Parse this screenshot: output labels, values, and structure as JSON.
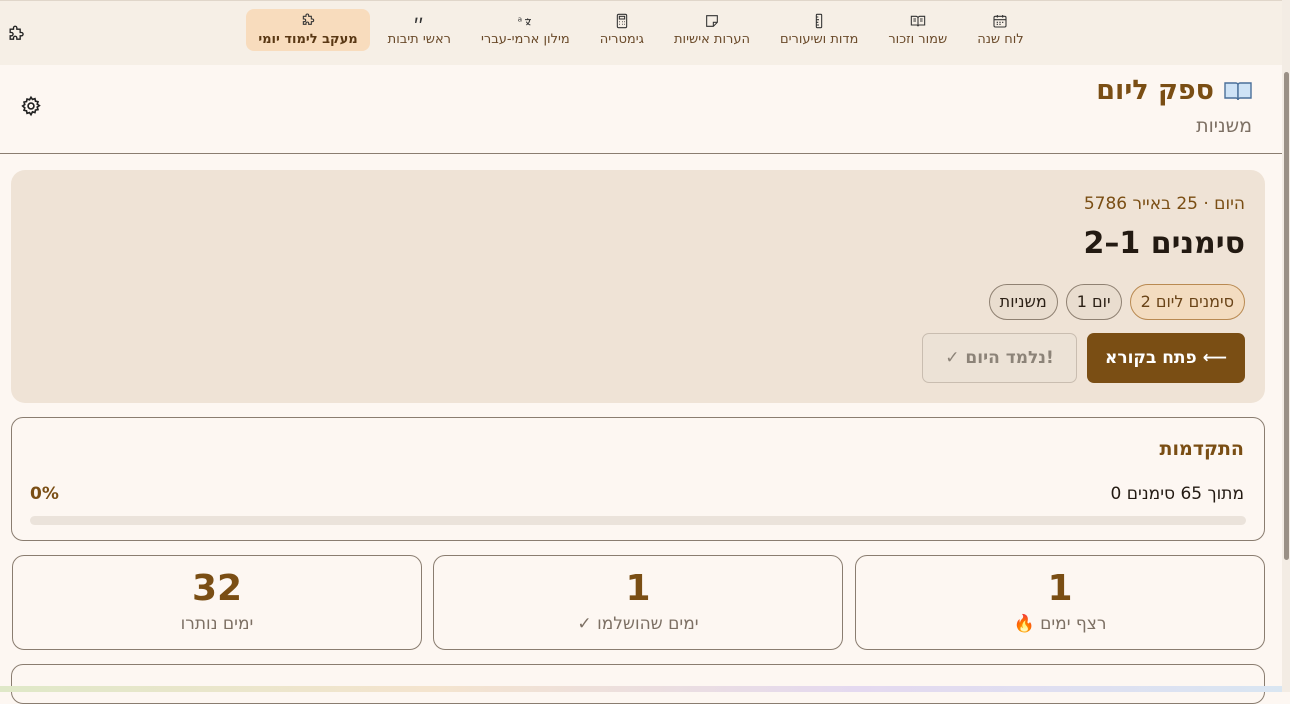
{
  "nav": {
    "items": [
      {
        "label": "לוח שנה",
        "icon": "calendar-icon"
      },
      {
        "label": "שמור וזכור",
        "icon": "open-book-icon"
      },
      {
        "label": "מדות ושיעורים",
        "icon": "ruler-icon"
      },
      {
        "label": "הערות אישיות",
        "icon": "note-icon"
      },
      {
        "label": "גימטריה",
        "icon": "calculator-icon"
      },
      {
        "label": "מילון ארמי-עברי",
        "icon": "translate-icon"
      },
      {
        "label": "ראשי תיבות",
        "icon": "quote-icon"
      },
      {
        "label": "מעקב לימוד יומי",
        "icon": "puzzle-icon",
        "active": true
      }
    ]
  },
  "header": {
    "title": "ספק ליום",
    "subtitle": "משניות"
  },
  "today": {
    "date": "היום · 25 באייר 5786",
    "range": "סימנים 1–2",
    "badges": [
      "2 סימנים ליום",
      "יום 1",
      "משניות"
    ],
    "open_button": "פתח בקורא ⟵",
    "learned_button": "✓ נלמד היום!"
  },
  "progress": {
    "title": "התקדמות",
    "count_text": "0 מתוך 65 סימנים",
    "percent_text": "0%",
    "fraction": 0
  },
  "stats": [
    {
      "value": "1",
      "label": "🔥 רצף ימים"
    },
    {
      "value": "1",
      "label": "✓ ימים שהושלמו"
    },
    {
      "value": "32",
      "label": "ימים נותרו"
    }
  ],
  "colors": {
    "accent": "#7a4e14",
    "background": "#fdf7f2",
    "card": "#efe3d6",
    "active_tab": "#f8dcbd"
  }
}
